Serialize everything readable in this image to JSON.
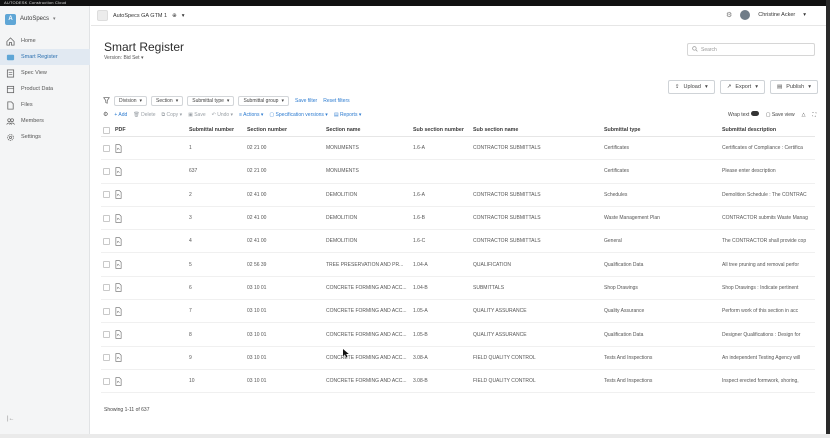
{
  "app": {
    "brand": "AUTODESK Construction Cloud"
  },
  "sidebar": {
    "project_name": "AutoSpecs",
    "items": [
      {
        "label": "Home",
        "icon": "home-icon"
      },
      {
        "label": "Smart Register",
        "icon": "register-icon",
        "active": true
      },
      {
        "label": "Spec View",
        "icon": "spec-view-icon"
      },
      {
        "label": "Product Data",
        "icon": "product-data-icon"
      },
      {
        "label": "Files",
        "icon": "files-icon"
      },
      {
        "label": "Members",
        "icon": "members-icon"
      },
      {
        "label": "Settings",
        "icon": "settings-icon"
      }
    ]
  },
  "topbar": {
    "project_selector": "AutoSpecs GA GTM 1",
    "user_name": "Christine Acker"
  },
  "header": {
    "title": "Smart Register",
    "version": "Version: Bid Set",
    "search_placeholder": "Search"
  },
  "actions": {
    "upload": "Upload",
    "export": "Export",
    "publish": "Publish"
  },
  "filters": {
    "chips": [
      "Division",
      "Section",
      "Submittal type",
      "Submittal group"
    ],
    "save_filter": "Save filter",
    "reset_filters": "Reset filters"
  },
  "toolbar": {
    "add": "+ Add",
    "delete": "Delete",
    "copy": "Copy",
    "save": "Save",
    "undo": "Undo",
    "actions": "Actions",
    "spec_versions": "Specification versions",
    "reports": "Reports",
    "wrap_text": "Wrap text",
    "save_view": "Save view"
  },
  "table": {
    "columns": [
      "PDF",
      "Submittal number",
      "Section number",
      "Section name",
      "Sub section number",
      "Sub section name",
      "Submittal type",
      "Submittal description"
    ],
    "rows": [
      {
        "num": "1",
        "sec": "02 21 00",
        "name": "MONUMENTS",
        "sub": "1.6-A",
        "subname": "CONTRACTOR SUBMITTALS",
        "type": "Certificates",
        "desc": "Certificates of Compliance : Certifica"
      },
      {
        "num": "637",
        "sec": "02 21 00",
        "name": "MONUMENTS",
        "sub": "",
        "subname": "",
        "type": "Certificates",
        "desc": "Please enter description"
      },
      {
        "num": "2",
        "sec": "02 41 00",
        "name": "DEMOLITION",
        "sub": "1.6-A",
        "subname": "CONTRACTOR SUBMITTALS",
        "type": "Schedules",
        "desc": "Demolition Schedule : The CONTRAC"
      },
      {
        "num": "3",
        "sec": "02 41 00",
        "name": "DEMOLITION",
        "sub": "1.6-B",
        "subname": "CONTRACTOR SUBMITTALS",
        "type": "Waste Management Plan",
        "desc": "CONTRACTOR submits Waste Manag"
      },
      {
        "num": "4",
        "sec": "02 41 00",
        "name": "DEMOLITION",
        "sub": "1.6-C",
        "subname": "CONTRACTOR SUBMITTALS",
        "type": "General",
        "desc": "The CONTRACTOR shall provide cop"
      },
      {
        "num": "5",
        "sec": "02 56 39",
        "name": "TREE PRESERVATION AND PR...",
        "sub": "1.04-A",
        "subname": "QUALIFICATION",
        "type": "Qualification Data",
        "desc": "All tree pruning and removal perfor"
      },
      {
        "num": "6",
        "sec": "03 10 01",
        "name": "CONCRETE FORMING AND ACC...",
        "sub": "1.04-B",
        "subname": "SUBMITTALS",
        "type": "Shop Drawings",
        "desc": "Shop Drawings : Indicate pertinent"
      },
      {
        "num": "7",
        "sec": "03 10 01",
        "name": "CONCRETE FORMING AND ACC...",
        "sub": "1.05-A",
        "subname": "QUALITY ASSURANCE",
        "type": "Quality Assurance",
        "desc": "Perform work of this section in acc"
      },
      {
        "num": "8",
        "sec": "03 10 01",
        "name": "CONCRETE FORMING AND ACC...",
        "sub": "1.05-B",
        "subname": "QUALITY ASSURANCE",
        "type": "Qualification Data",
        "desc": "Designer Qualifications : Design for"
      },
      {
        "num": "9",
        "sec": "03 10 01",
        "name": "CONCRETE FORMING AND ACC...",
        "sub": "3.08-A",
        "subname": "FIELD QUALITY CONTROL",
        "type": "Tests And Inspections",
        "desc": "An independent Testing Agency will"
      },
      {
        "num": "10",
        "sec": "03 10 01",
        "name": "CONCRETE FORMING AND ACC...",
        "sub": "3.08-B",
        "subname": "FIELD QUALITY CONTROL",
        "type": "Tests And Inspections",
        "desc": "Inspect erected formwork, shoring,"
      }
    ]
  },
  "footer": {
    "showing": "Showing 1-11 of 637"
  }
}
